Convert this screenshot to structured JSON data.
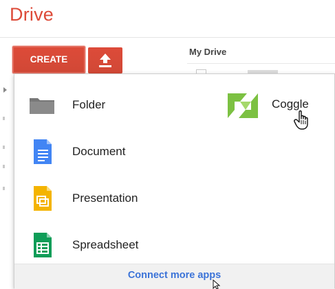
{
  "app": {
    "title": "Drive"
  },
  "toolbar": {
    "create_label": "CREATE",
    "upload_icon": "upload-arrow-icon"
  },
  "content": {
    "section_title": "My Drive"
  },
  "menu": {
    "items": [
      {
        "label": "Folder",
        "icon": "folder-icon"
      },
      {
        "label": "Document",
        "icon": "document-icon"
      },
      {
        "label": "Presentation",
        "icon": "presentation-icon"
      },
      {
        "label": "Spreadsheet",
        "icon": "spreadsheet-icon"
      }
    ],
    "apps": [
      {
        "label": "Coggle",
        "icon": "coggle-icon"
      }
    ],
    "footer_link": "Connect more apps"
  },
  "colors": {
    "brand_red": "#dd4b39",
    "folder_grey": "#777777",
    "docs_blue": "#4285f4",
    "slides_yellow": "#f4b400",
    "sheets_green": "#0f9d58",
    "coggle_green": "#7cc142",
    "link_blue": "#3b73d8"
  }
}
